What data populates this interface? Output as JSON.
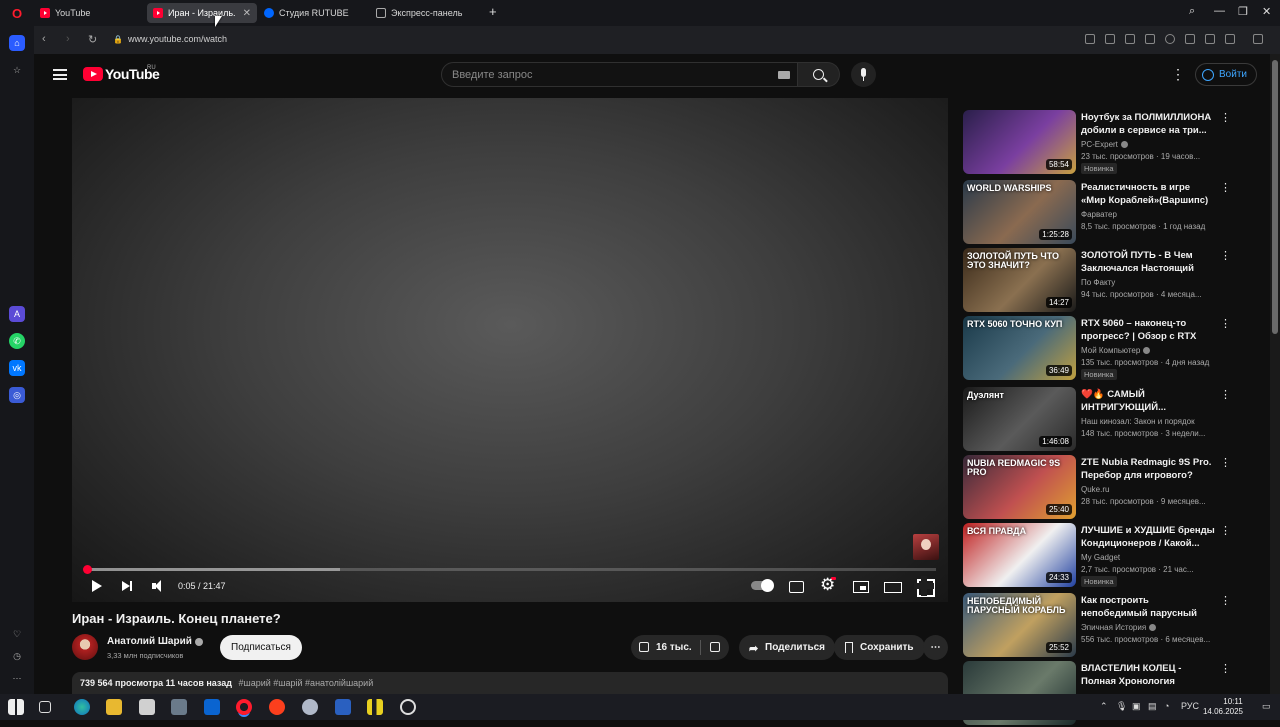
{
  "browser": {
    "tabs": [
      {
        "label": "YouTube",
        "active": false
      },
      {
        "label": "Иран - Израиль. Кон",
        "active": true
      },
      {
        "label": "Студия RUTUBE",
        "active": false
      },
      {
        "label": "Экспресс-панель",
        "active": false
      }
    ],
    "url": "www.youtube.com/watch"
  },
  "header": {
    "logo_text": "YouTube",
    "region": "RU",
    "search_placeholder": "Введите запрос",
    "signin_label": "Войти"
  },
  "player": {
    "current_time": "0:05",
    "duration": "21:47",
    "time_display": "0:05 / 21:47",
    "played_fraction": 0.004,
    "buffered_fraction": 0.3
  },
  "video": {
    "title": "Иран - Израиль. Конец планете?",
    "channel": "Анатолий Шарий",
    "subscribers": "3,33 млн подписчиков",
    "subscribe_label": "Подписаться",
    "likes": "16 тыс.",
    "share_label": "Поделиться",
    "save_label": "Сохранить",
    "views_time": "739 564 просмотра  11 часов назад",
    "tags": "#шарий #шарій #анатолійшарий"
  },
  "recommendations": [
    {
      "title": "Ноутбук за ПОЛМИЛЛИОНА добили в сервисе на три...",
      "channel": "PC-Expert",
      "verified": true,
      "meta": "23 тыс. просмотров · 19 часов...",
      "badge": "Новинка",
      "duration": "58:54",
      "thumb_text": "",
      "thumb_colors": [
        "#2a1f4a",
        "#7a3fa0",
        "#c8a040"
      ]
    },
    {
      "title": "Реалистичность в игре «Мир Кораблей»(Варшипс)",
      "channel": "Фарватер",
      "verified": false,
      "meta": "8,5 тыс. просмотров · 1 год назад",
      "badge": "",
      "duration": "1:25:28",
      "thumb_text": "WORLD WARSHIPS",
      "thumb_colors": [
        "#2a3a4a",
        "#8a6a50",
        "#3a4a5a"
      ]
    },
    {
      "title": "ЗОЛОТОЙ ПУТЬ - В Чем Заключался Настоящий Пла...",
      "channel": "По Факту",
      "verified": false,
      "meta": "94 тыс. просмотров · 4 месяца...",
      "badge": "",
      "duration": "14:27",
      "thumb_text": "ЗОЛОТОЙ ПУТЬ ЧТО ЭТО ЗНАЧИТ?",
      "thumb_colors": [
        "#3a2a1a",
        "#8a7050",
        "#1a1a1a"
      ]
    },
    {
      "title": "RTX 5060 – наконец-то прогресс? | Обзор с RTX 406...",
      "channel": "Мой Компьютер",
      "verified": true,
      "meta": "135 тыс. просмотров · 4 дня назад",
      "badge": "Новинка",
      "duration": "36:49",
      "thumb_text": "RTX 5060 ТОЧНО КУП",
      "thumb_colors": [
        "#1a3a4a",
        "#4a6a7a",
        "#c0a040"
      ]
    },
    {
      "title": "❤️🔥 САМЫЙ ИНТРИГУЮЩИЙ...",
      "channel": "Наш кинозал: Закон и порядок",
      "verified": false,
      "meta": "148 тыс. просмотров · 3 недели...",
      "badge": "",
      "duration": "1:46:08",
      "thumb_text": "Дуэлянт",
      "thumb_colors": [
        "#1a1a1a",
        "#5a5a5a",
        "#2a2a2a"
      ]
    },
    {
      "title": "ZTE Nubia Redmagic 9S Pro. Перебор для игрового?",
      "channel": "Quke.ru",
      "verified": false,
      "meta": "28 тыс. просмотров · 9 месяцев...",
      "badge": "",
      "duration": "25:40",
      "thumb_text": "NUBIA REDMAGIC 9S PRO",
      "thumb_colors": [
        "#3a2a3a",
        "#c05050",
        "#e0a030"
      ]
    },
    {
      "title": "ЛУЧШИЕ и ХУДШИЕ бренды Кондиционеров / Какой...",
      "channel": "My Gadget",
      "verified": false,
      "meta": "2,7 тыс. просмотров · 21 час...",
      "badge": "Новинка",
      "duration": "24:33",
      "thumb_text": "ВСЯ ПРАВДА",
      "thumb_colors": [
        "#c02020",
        "#f0f0f0",
        "#2040a0"
      ]
    },
    {
      "title": "Как построить непобедимый парусный корабль",
      "channel": "Эпичная История",
      "verified": true,
      "meta": "556 тыс. просмотров · 6 месяцев...",
      "badge": "",
      "duration": "25:52",
      "thumb_text": "НЕПОБЕДИМЫЙ ПАРУСНЫЙ КОРАБЛЬ",
      "thumb_colors": [
        "#3a5a7a",
        "#c0a060",
        "#2a3a4a"
      ]
    },
    {
      "title": "ВЛАСТЕЛИН КОЛЕЦ - Полная Хронология Вселенной...",
      "channel": "",
      "verified": false,
      "meta": "",
      "badge": "",
      "duration": "",
      "thumb_text": "",
      "thumb_colors": [
        "#2a3a3a",
        "#6a7a6a",
        "#1a2a2a"
      ]
    }
  ],
  "taskbar": {
    "lang": "РУС",
    "time": "10:11",
    "date": "14.06.2025"
  }
}
